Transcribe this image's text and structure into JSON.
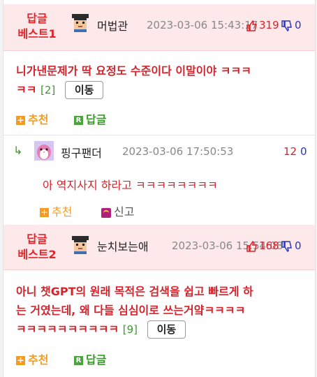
{
  "posts": [
    {
      "best_label_line1": "답글",
      "best_label_line2": "베스트1",
      "nickname": "머법관",
      "date": "2023-03-06 15:43:17",
      "up": "319",
      "down": "0",
      "title_line1": "니가낸문제가 딱 요정도 수준이다 이말이야 ㅋㅋㅋ",
      "title_line2": "ㅋㅋ",
      "comment_count": "[2]",
      "move_label": "이동",
      "recommend_label": "추천",
      "reply_label": "답글"
    },
    {
      "best_label_line1": "답글",
      "best_label_line2": "베스트2",
      "nickname": "눈치보는애",
      "date": "2023-03-06 15:54:08",
      "up": "168",
      "down": "0",
      "title_line1": "아니 챗GPT의 원래 목적은 검색을 쉽고 빠르게 하",
      "title_line2": "는 거였는데, 왜 다들 심심이로 쓰는거얔ㅋㅋㅋㅋ",
      "title_line3": "ㅋㅋㅋㅋㅋㅋㅋㅋㅋㅋ",
      "comment_count": "[9]",
      "move_label": "이동",
      "recommend_label": "추천",
      "reply_label": "답글"
    }
  ],
  "reply": {
    "nickname": "핑구팬더",
    "date": "2023-03-06 17:50:53",
    "up": "12",
    "down": "0",
    "text": "아 역지사지 하라고 ㅋㅋㅋㅋㅋㅋㅋㅋ",
    "recommend_label": "추천",
    "report_label": "신고"
  },
  "colors": {
    "best_bg": "#fde9ea",
    "accent_red": "#d6232b",
    "accent_blue": "#2a35b8",
    "accent_green": "#3a9a2a",
    "recommend_orange": "#f39c24"
  },
  "icons": {
    "avatar": "pixel-face-avatar",
    "penguin": "penguin-avatar",
    "up": "thumbs-up-icon",
    "down": "thumbs-down-icon",
    "reply_arrow": "reply-arrow-icon",
    "report": "report-siren-icon"
  }
}
